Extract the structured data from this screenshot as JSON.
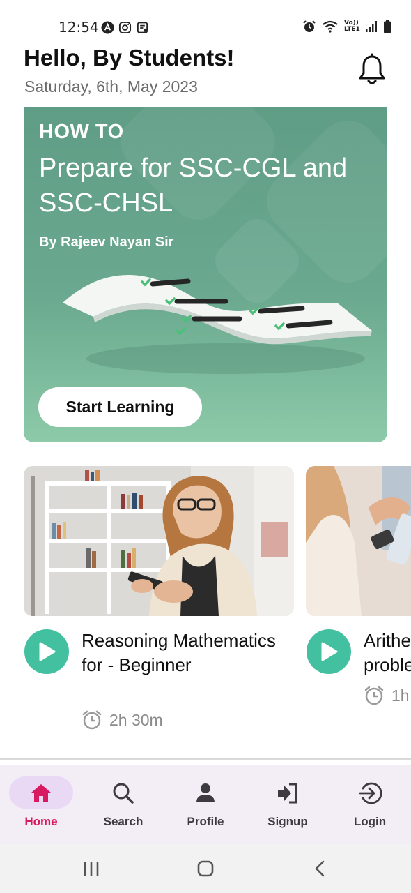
{
  "status_bar": {
    "time": "12:54",
    "left_icons": [
      "app-a-icon",
      "instagram-icon",
      "notes-icon"
    ],
    "right_icons": [
      "alarm-icon",
      "wifi-icon",
      "volte-icon",
      "signal-icon",
      "battery-icon"
    ],
    "volte_text": "Vo)) LTE1"
  },
  "header": {
    "greeting": "Hello, By Students!",
    "date": "Saturday, 6th, May 2023",
    "bell_icon": "bell-icon"
  },
  "hero": {
    "kicker": "HOW TO",
    "title": "Prepare for SSC-CGL and SSC-CHSL",
    "author": "By Rajeev Nayan Sir",
    "button_label": "Start Learning",
    "gradient_top": "#5f9d86",
    "gradient_bottom": "#8ccaa9"
  },
  "courses": [
    {
      "title": "Reasoning Mathematics for - Beginner",
      "duration": "2h 30m",
      "play_icon": "play-icon",
      "clock_icon": "clock-icon"
    },
    {
      "title": "Arithe proble",
      "duration": "1h",
      "play_icon": "play-icon",
      "clock_icon": "clock-icon"
    }
  ],
  "bottom_nav": {
    "items": [
      {
        "label": "Home",
        "icon": "home-icon",
        "active": true
      },
      {
        "label": "Search",
        "icon": "search-icon",
        "active": false
      },
      {
        "label": "Profile",
        "icon": "person-icon",
        "active": false
      },
      {
        "label": "Signup",
        "icon": "signup-icon",
        "active": false
      },
      {
        "label": "Login",
        "icon": "login-icon",
        "active": false
      }
    ],
    "active_color": "#d81b60",
    "background": "#f3edf6"
  },
  "accent": {
    "play": "#42c0a0"
  }
}
